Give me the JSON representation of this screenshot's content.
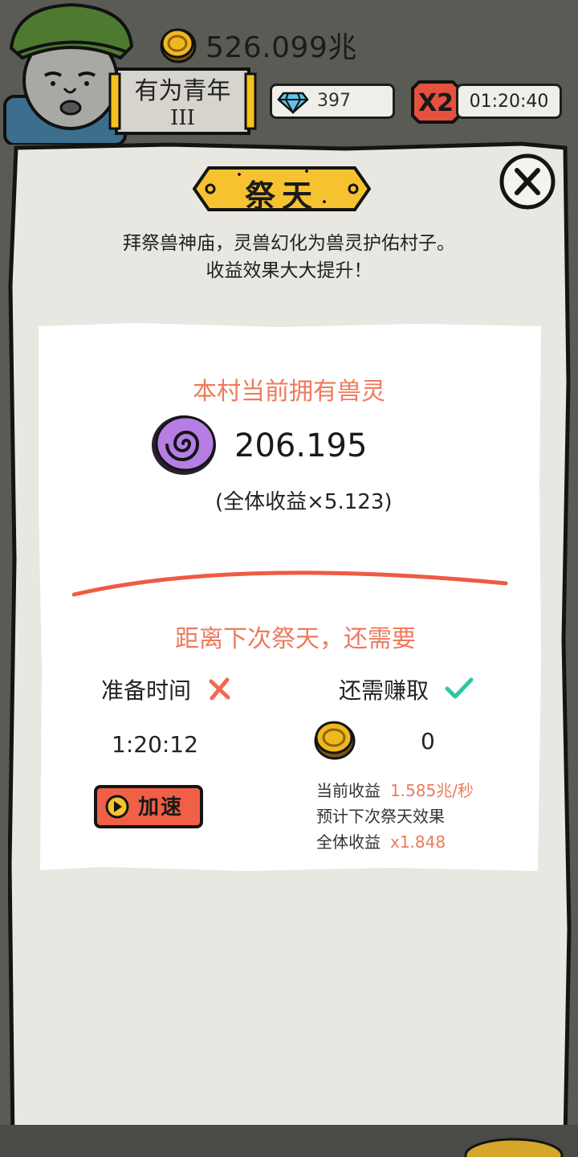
{
  "header": {
    "coin_total": "526.099兆",
    "rank": {
      "title": "有为青年",
      "level": "III"
    },
    "gems": "397",
    "boost": {
      "label": "X2",
      "timer": "01:20:40"
    }
  },
  "dialog": {
    "title": "祭天",
    "description_line1": "拜祭兽神庙，灵兽幻化为兽灵护佑村子。",
    "description_line2": "收益效果大大提升！",
    "owned_title": "本村当前拥有兽灵",
    "spirit_count": "206.195",
    "spirit_bonus": "(全体收益×5.123)",
    "next_title": "距离下次祭天，还需要",
    "prep": {
      "label": "准备时间",
      "time": "1:20:12",
      "done": false
    },
    "earn": {
      "label": "还需赚取",
      "amount": "0",
      "done": true
    },
    "speed_button": "加速",
    "stats": {
      "current_income_label": "当前收益",
      "current_income_value": "1.585兆/秒",
      "forecast_label": "预计下次祭天效果",
      "total_income_label": "全体收益",
      "total_income_value": "x1.848"
    }
  },
  "colors": {
    "accent_orange": "#ee7a5d",
    "banner_yellow": "#f7c230",
    "check_green": "#2ec7a0",
    "cross_red": "#ee6a52",
    "spirit_purple": "#b67ee4",
    "coin_gold": "#f0b81e",
    "x2_red": "#e4513e"
  },
  "icons": {
    "coin": "gold-coin-icon",
    "gem": "diamond-icon",
    "close": "close-icon",
    "spirit": "spiral-spirit-icon",
    "cross": "cross-icon",
    "check": "check-icon",
    "play": "play-icon"
  }
}
